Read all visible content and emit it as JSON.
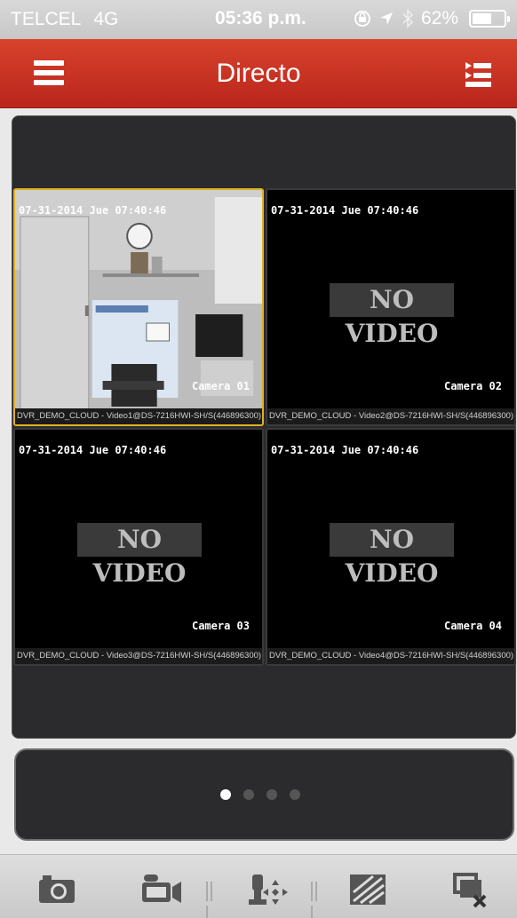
{
  "status_bar": {
    "signal": "●●●●●",
    "carrier": "TELCEL",
    "network": "4G",
    "time": "05:36 p.m.",
    "battery": "62%",
    "battery_level": 0.62
  },
  "header": {
    "title": "Directo",
    "left_icon": "hamburger-menu-icon",
    "right_icon": "device-list-icon",
    "accent": "#c9301f"
  },
  "cameras": [
    {
      "osd_time": "07-31-2014 Jue 07:40:46",
      "name": "Camera 01",
      "caption": "DVR_DEMO_CLOUD - Video1@DS-7216HWI-SH/S(446896300)",
      "no_video": "",
      "selected": true
    },
    {
      "osd_time": "07-31-2014 Jue 07:40:46",
      "name": "Camera 02",
      "caption": "DVR_DEMO_CLOUD - Video2@DS-7216HWI-SH/S(446896300)",
      "no_video": "NO VIDEO",
      "selected": false
    },
    {
      "osd_time": "07-31-2014 Jue 07:40:46",
      "name": "Camera 03",
      "caption": "DVR_DEMO_CLOUD - Video3@DS-7216HWI-SH/S(446896300)",
      "no_video": "NO VIDEO",
      "selected": false
    },
    {
      "osd_time": "07-31-2014 Jue 07:40:46",
      "name": "Camera 04",
      "caption": "DVR_DEMO_CLOUD - Video4@DS-7216HWI-SH/S(446896300)",
      "no_video": "NO VIDEO",
      "selected": false
    }
  ],
  "pager": {
    "pages": 4,
    "current": 1
  },
  "toolbar": {
    "icons": [
      "snapshot-camera-icon",
      "record-video-icon",
      "ptz-control-icon",
      "image-quality-icon",
      "stop-all-icon"
    ]
  }
}
